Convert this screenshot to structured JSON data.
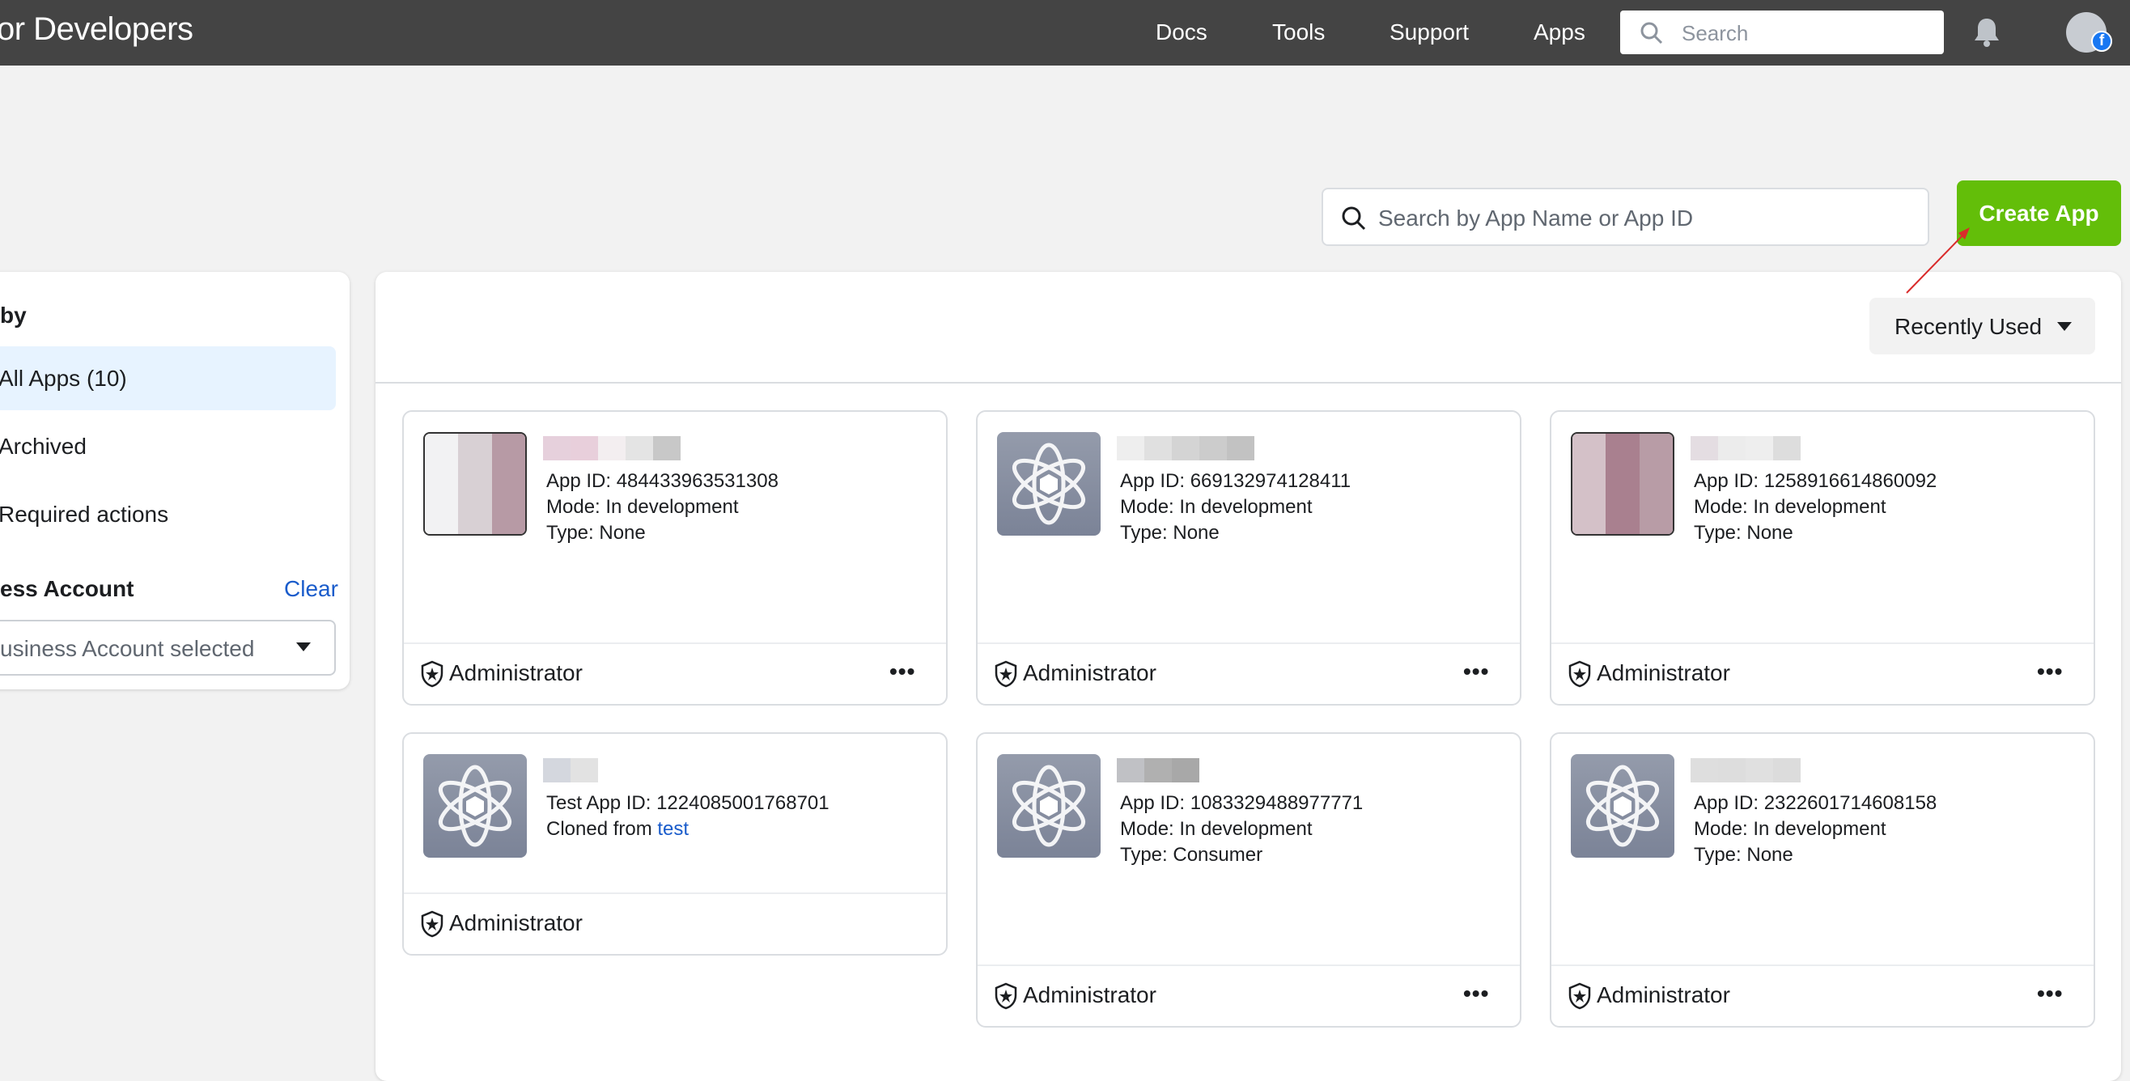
{
  "header": {
    "brand": "or Developers",
    "nav": [
      "Docs",
      "Tools",
      "Support",
      "Apps"
    ],
    "search_placeholder": "Search"
  },
  "toolbar": {
    "search_placeholder": "Search by App Name or App ID",
    "create_label": "Create App"
  },
  "sidebar": {
    "filter_title": "by",
    "items": [
      {
        "label": "All Apps (10)",
        "active": true
      },
      {
        "label": "Archived"
      },
      {
        "label": "Required actions"
      }
    ],
    "business_title": "ess Account",
    "clear_label": "Clear",
    "business_select": "usiness Account selected"
  },
  "sort": {
    "label": "Recently Used"
  },
  "colors": {
    "accent_green": "#63be09",
    "header_bg": "#444444",
    "link": "#1a5ccb",
    "active_item": "#e7f3ff"
  },
  "apps": [
    {
      "line1": "App ID: 484433963531308",
      "line2": "Mode: In development",
      "line3": "Type: None",
      "role": "Administrator",
      "icon": "custom-image"
    },
    {
      "line1": "App ID: 669132974128411",
      "line2": "Mode: In development",
      "line3": "Type: None",
      "role": "Administrator",
      "icon": "atom-icon"
    },
    {
      "line1": "App ID: 1258916614860092",
      "line2": "Mode: In development",
      "line3": "Type: None",
      "role": "Administrator",
      "icon": "custom-image"
    },
    {
      "line1": "Test App ID: 1224085001768701",
      "line2_prefix": "Cloned from ",
      "line2_link": "test",
      "role": "Administrator",
      "icon": "atom-icon"
    },
    {
      "line1": "App ID: 1083329488977771",
      "line2": "Mode: In development",
      "line3": "Type: Consumer",
      "role": "Administrator",
      "icon": "atom-icon"
    },
    {
      "line1": "App ID: 2322601714608158",
      "line2": "Mode: In development",
      "line3": "Type: None",
      "role": "Administrator",
      "icon": "atom-icon"
    }
  ]
}
